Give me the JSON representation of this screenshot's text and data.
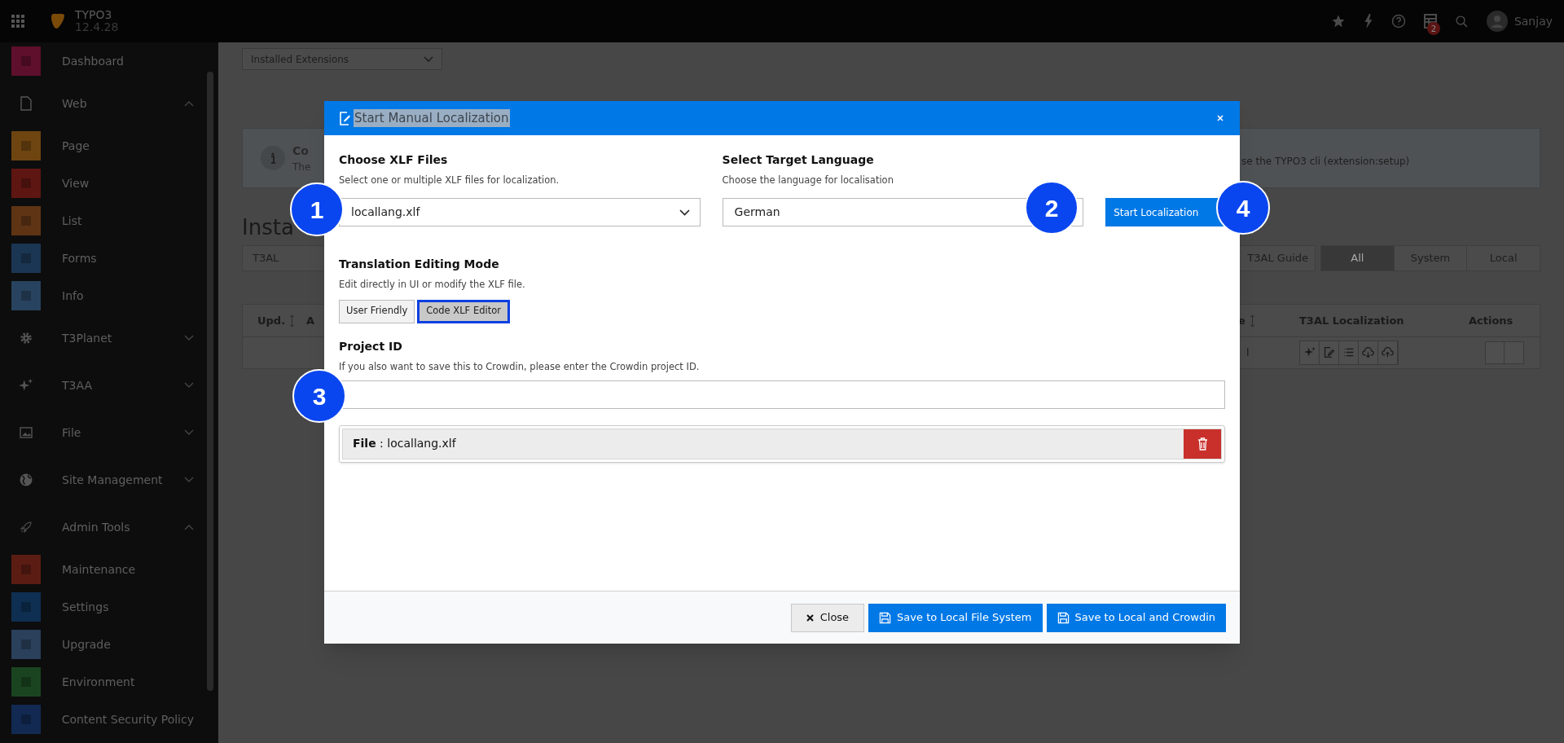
{
  "top_bar": {
    "logo_title": "TYPO3",
    "version": "12.4.28",
    "notifications_badge": "2",
    "user_name": "Sanjay"
  },
  "sidebar": {
    "items": [
      {
        "kind": "module",
        "label": "Dashboard",
        "color": "#5e0f2c"
      },
      {
        "kind": "group",
        "label": "Web",
        "expanded": true,
        "children": [
          {
            "kind": "module",
            "label": "Page",
            "color": "#6e4510"
          },
          {
            "kind": "module",
            "label": "View",
            "color": "#5e1612"
          },
          {
            "kind": "module",
            "label": "List",
            "color": "#5f3414"
          },
          {
            "kind": "module",
            "label": "Forms",
            "color": "#1b3653"
          },
          {
            "kind": "module",
            "label": "Info",
            "color": "#28435f"
          }
        ]
      },
      {
        "kind": "group",
        "label": "T3Planet",
        "expanded": false
      },
      {
        "kind": "group",
        "label": "T3AA",
        "expanded": false
      },
      {
        "kind": "group",
        "label": "File",
        "expanded": false
      },
      {
        "kind": "group",
        "label": "Site Management",
        "expanded": false
      },
      {
        "kind": "group",
        "label": "Admin Tools",
        "expanded": true,
        "children": [
          {
            "kind": "module",
            "label": "Maintenance",
            "color": "#5b1d13"
          },
          {
            "kind": "module",
            "label": "Settings",
            "color": "#0e2f52"
          },
          {
            "kind": "module",
            "label": "Upgrade",
            "color": "#2a405b"
          },
          {
            "kind": "module",
            "label": "Environment",
            "color": "#1a4420"
          },
          {
            "kind": "module",
            "label": "Content Security Policy",
            "color": "#122a52"
          }
        ]
      }
    ]
  },
  "content": {
    "view_select": "Installed Extensions",
    "info_box": {
      "title": "Co",
      "text_start": "The",
      "text_end": "se the TYPO3 cli (extension:setup)"
    },
    "heading": "Insta",
    "search_field": {
      "value": "T3AL"
    },
    "guide_button": "T3AL Guide",
    "filters": [
      {
        "label": "All",
        "selected": true
      },
      {
        "label": "System",
        "selected": false
      },
      {
        "label": "Local",
        "selected": false
      }
    ],
    "table": {
      "columns": [
        "Upd.",
        "A",
        "e",
        "T3AL Localization",
        "Actions"
      ],
      "rows": [
        {
          "column_3": "l"
        }
      ]
    }
  },
  "modal": {
    "title": "Start Manual Localization",
    "files_section": {
      "label": "Choose XLF Files",
      "hint": "Select one or multiple XLF files for localization.",
      "value": "locallang.xlf"
    },
    "language_section": {
      "label": "Select Target Language",
      "hint": "Choose the language for localisation",
      "value": "German"
    },
    "start_button": "Start Localization",
    "mode_section": {
      "label": "Translation Editing Mode",
      "hint": "Edit directly in UI or modify the XLF file.",
      "options": [
        {
          "label": "User Friendly",
          "selected": false
        },
        {
          "label": "Code XLF Editor",
          "selected": true
        }
      ]
    },
    "project_section": {
      "label": "Project ID",
      "hint": "If you also want to save this to Crowdin, please enter the Crowdin project ID."
    },
    "files": [
      "**File** : locallang.xlf"
    ],
    "buttons": [
      {
        "kind": "close",
        "label": "Close"
      },
      {
        "kind": "save",
        "label": "Save to Local File System"
      },
      {
        "kind": "save",
        "label": "Save to Local and Crowdin"
      }
    ]
  },
  "step_markers": [
    "1",
    "2",
    "4",
    "3"
  ]
}
